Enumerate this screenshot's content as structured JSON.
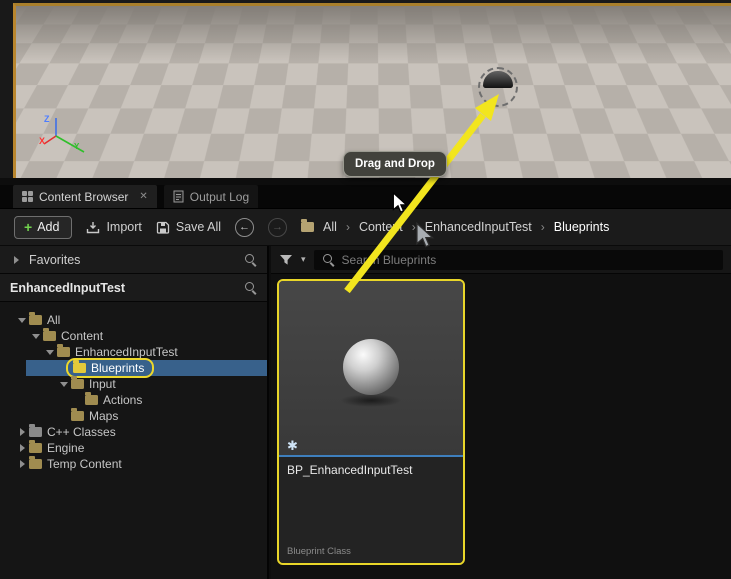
{
  "viewport": {
    "gizmo": {
      "z": "Z",
      "x": "X",
      "y": "Y"
    }
  },
  "drag_tooltip": "Drag and Drop",
  "tabs": {
    "content_browser": "Content Browser",
    "output_log": "Output Log"
  },
  "toolbar": {
    "add": "Add",
    "import": "Import",
    "save_all": "Save All",
    "all": "All",
    "breadcrumb": [
      "Content",
      "EnhancedInputTest",
      "Blueprints"
    ]
  },
  "left_panel": {
    "favorites": "Favorites",
    "collection": "EnhancedInputTest",
    "tree": [
      {
        "label": "All"
      },
      {
        "label": "Content"
      },
      {
        "label": "EnhancedInputTest"
      },
      {
        "label": "Blueprints"
      },
      {
        "label": "Input"
      },
      {
        "label": "Actions"
      },
      {
        "label": "Maps"
      },
      {
        "label": "C++ Classes"
      },
      {
        "label": "Engine"
      },
      {
        "label": "Temp Content"
      }
    ]
  },
  "content": {
    "search_placeholder": "Search Blueprints",
    "asset": {
      "name": "BP_EnhancedInputTest",
      "type": "Blueprint Class"
    }
  },
  "icons": {
    "plus": "+",
    "close": "✕",
    "back": "←",
    "forward": "→",
    "separator": "›",
    "caret_down": "▾",
    "dirty_star": "✱"
  },
  "colors": {
    "highlight_yellow": "#e9d629",
    "selection_blue": "#38618b",
    "blueprint_bar_blue": "#3e7fbd",
    "add_green": "#71d24e",
    "viewport_border_orange": "#b9862e"
  }
}
